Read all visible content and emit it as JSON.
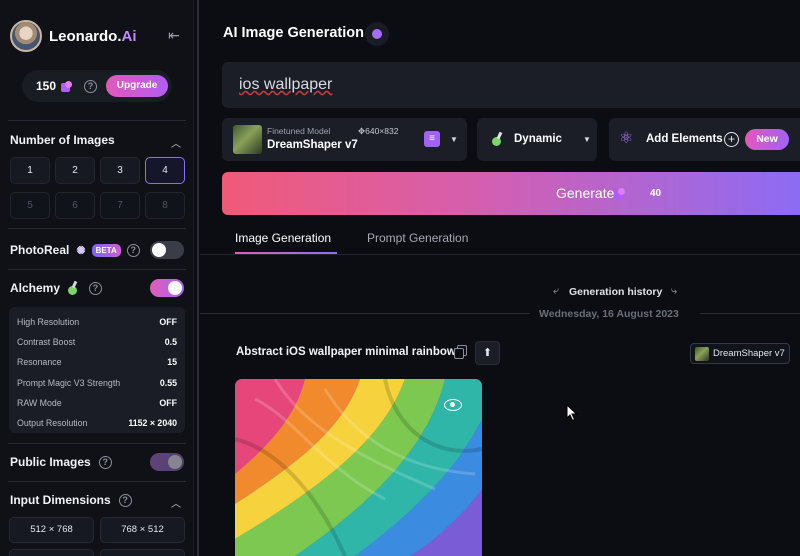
{
  "brand": {
    "name": "Leonardo.",
    "name_suffix": "Ai"
  },
  "credits": {
    "count": "150",
    "upgrade_label": "Upgrade"
  },
  "number_of_images": {
    "title": "Number of Images",
    "options": [
      {
        "label": "1",
        "state": "normal"
      },
      {
        "label": "2",
        "state": "normal"
      },
      {
        "label": "3",
        "state": "normal"
      },
      {
        "label": "4",
        "state": "selected"
      },
      {
        "label": "5",
        "state": "disabled"
      },
      {
        "label": "6",
        "state": "disabled"
      },
      {
        "label": "7",
        "state": "disabled"
      },
      {
        "label": "8",
        "state": "disabled"
      }
    ]
  },
  "photoreal": {
    "label": "PhotoReal",
    "badge": "BETA",
    "enabled": false
  },
  "alchemy": {
    "label": "Alchemy",
    "enabled": true,
    "settings": [
      {
        "key": "High Resolution",
        "value": "OFF"
      },
      {
        "key": "Contrast Boost",
        "value": "0.5"
      },
      {
        "key": "Resonance",
        "value": "15"
      },
      {
        "key": "Prompt Magic V3 Strength",
        "value": "0.55"
      },
      {
        "key": "RAW Mode",
        "value": "OFF"
      },
      {
        "key": "Output Resolution",
        "value": "1152 × 2040"
      }
    ]
  },
  "public_images": {
    "label": "Public Images",
    "enabled": true
  },
  "input_dimensions": {
    "title": "Input Dimensions",
    "options": [
      "512 × 768",
      "768 × 512"
    ]
  },
  "main": {
    "title": "AI Image Generation",
    "prompt": "ios wallpaper",
    "model": {
      "kind": "Finetuned Model",
      "resolution": "✥640×832",
      "name": "DreamShaper v7"
    },
    "style": {
      "label": "Dynamic"
    },
    "elements": {
      "label": "Add Elements",
      "badge": "New"
    },
    "generate": {
      "label": "Generate",
      "cost": "40"
    },
    "tabs": [
      {
        "label": "Image Generation",
        "active": true
      },
      {
        "label": "Prompt Generation",
        "active": false
      }
    ],
    "history_label": "Generation history",
    "date_label": "Wednesday, 16 August 2023",
    "generation": {
      "title": "Abstract iOS wallpaper minimal rainbow",
      "model_tag": "DreamShaper v7"
    }
  },
  "colors": {
    "accent_pink": "#e457b9",
    "accent_purple": "#9f63f4",
    "background": "#0b0d12"
  }
}
